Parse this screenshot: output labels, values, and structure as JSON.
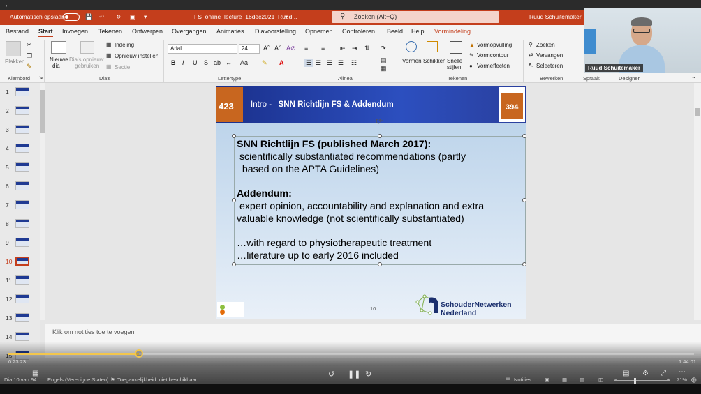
{
  "titlebar": {
    "autosave_label": "Automatisch opslaan",
    "filename": "FS_online_lecture_16dec2021_Ruud...",
    "search_placeholder": "Zoeken (Alt+Q)",
    "user_name": "Ruud Schuitemaker"
  },
  "menu": {
    "tabs": [
      "Bestand",
      "Start",
      "Invoegen",
      "Tekenen",
      "Ontwerpen",
      "Overgangen",
      "Animaties",
      "Diavoorstelling",
      "Opnemen",
      "Controleren",
      "Beeld",
      "Help",
      "Vormindeling"
    ],
    "active": "Start"
  },
  "ribbon": {
    "plakken": "Plakken",
    "klembord": "Klembord",
    "nieuwe_dia_1": "Nieuwe",
    "nieuwe_dia_2": "dia",
    "dia_opnieuw_1": "Dia's opnieuw",
    "dia_opnieuw_2": "gebruiken",
    "indeling": "Indeling",
    "opnieuw_instellen": "Opnieuw instellen",
    "sectie": "Sectie",
    "dias_label": "Dia's",
    "font_name": "Arial",
    "font_size": "24",
    "lettertype_label": "Lettertype",
    "alinea_label": "Alinea",
    "vormen": "Vormen",
    "schikken": "Schikken",
    "snelle_stijlen_1": "Snelle",
    "snelle_stijlen_2": "stijlen",
    "vormopvulling": "Vormopvulling",
    "vormcontour": "Vormcontour",
    "vormeffecten": "Vormeffecten",
    "tekenen_label": "Tekenen",
    "zoeken": "Zoeken",
    "vervangen": "Vervangen",
    "selecteren": "Selecteren",
    "bewerken_label": "Bewerken",
    "spraak_label": "Spraak",
    "designer_label": "Designer"
  },
  "webcam": {
    "name": "Ruud Schuitemaker"
  },
  "thumbnails": [
    "1",
    "2",
    "3",
    "4",
    "5",
    "6",
    "7",
    "8",
    "9",
    "10",
    "11",
    "12",
    "13",
    "14",
    "15"
  ],
  "active_slide": "10",
  "slide": {
    "badge_left": "423",
    "badge_right": "394",
    "title_prefix": "Intro  -",
    "title_main": "SNN Richtlijn FS & Addendum",
    "line1": "SNN Richtlijn FS (published March 2017):",
    "line2": " scientifically substantiated recommendations (partly",
    "line3": "  based on the APTA Guidelines)",
    "line4": "Addendum:",
    "line5": " expert opinion, accountability and explanation and extra",
    "line6": "valuable knowledge (not scientifically substantiated)",
    "line7": "…with regard to physiotherapeutic treatment",
    "line8": "…literature up to early 2016 included",
    "number": "10",
    "logo_right_1": "SchouderNetwerken",
    "logo_right_2": "Nederland"
  },
  "notes_placeholder": "Klik om notities toe te voegen",
  "video": {
    "current_time": "0:23:23",
    "total_time": "1:44:01",
    "progress": 0.19
  },
  "status": {
    "slide_info": "Dia 10 van 94",
    "language": "Engels (Verenigde Staten)",
    "accessibility": "Toegankelijkheid: niet beschikbaar",
    "notes": "Notities",
    "zoom": "71%"
  },
  "colors": {
    "accent": "#c43e1c",
    "progress": "#f3c64c",
    "slide_header": "#1f3a93"
  }
}
